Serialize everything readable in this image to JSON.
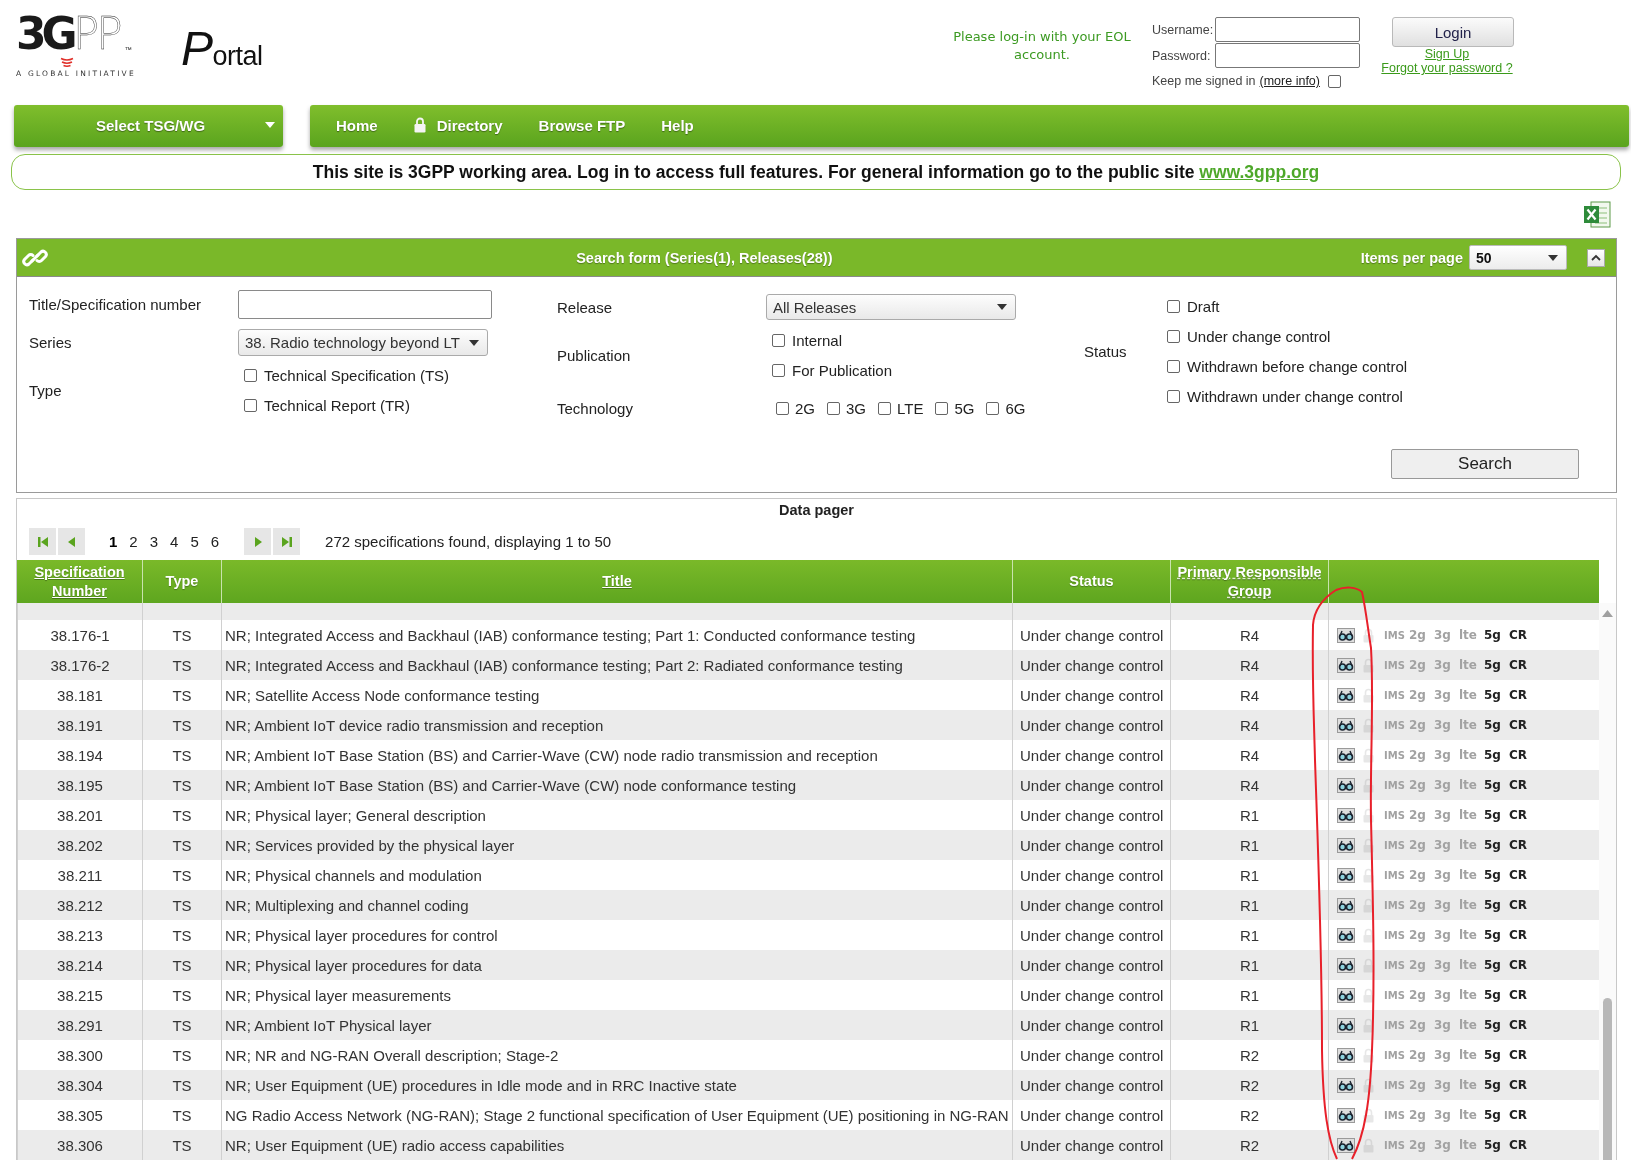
{
  "header": {
    "logo": {
      "wordmark": "3GPP",
      "trademark": "™",
      "tagline": "A GLOBAL INITIATIVE"
    },
    "portal_title": "Portal",
    "login": {
      "prompt": "Please log-in with your EOL account.",
      "username_label": "Username:",
      "password_label": "Password:",
      "keep_signed_in": {
        "label": "Keep me signed in",
        "link": "(more info)",
        "checked": false
      },
      "login_button": "Login",
      "sign_up": "Sign Up",
      "forgot_password": "Forgot your password ?"
    }
  },
  "nav": {
    "tsg_select": "Select TSG/WG",
    "items": [
      {
        "label": "Home",
        "locked": false
      },
      {
        "label": "Directory",
        "locked": true
      },
      {
        "label": "Browse FTP",
        "locked": false
      },
      {
        "label": "Help",
        "locked": false
      }
    ]
  },
  "banner": {
    "text": "This site is 3GPP working area. Log in to access full features. For general information go to the public site",
    "link": "www.3gpp.org"
  },
  "search_form": {
    "title": "Search form (Series(1), Releases(28))",
    "items_per_page_label": "Items per page",
    "items_per_page": "50",
    "expanded": true,
    "title_label": "Title/Specification number",
    "series_label": "Series",
    "series": "38. Radio technology beyond LT",
    "type_label": "Type",
    "types": [
      {
        "label": "Technical Specification (TS)",
        "checked": false
      },
      {
        "label": "Technical Report (TR)",
        "checked": false
      }
    ],
    "release_label": "Release",
    "release": "All Releases",
    "publication_label": "Publication",
    "publications": [
      {
        "label": "Internal",
        "checked": false
      },
      {
        "label": "For Publication",
        "checked": false
      }
    ],
    "technology_label": "Technology",
    "technologies": [
      {
        "label": "2G",
        "checked": false
      },
      {
        "label": "3G",
        "checked": false
      },
      {
        "label": "LTE",
        "checked": false
      },
      {
        "label": "5G",
        "checked": false
      },
      {
        "label": "6G",
        "checked": false
      }
    ],
    "status_label": "Status",
    "statuses": [
      {
        "label": "Draft",
        "checked": false
      },
      {
        "label": "Under change control",
        "checked": false
      },
      {
        "label": "Withdrawn before change control",
        "checked": false
      },
      {
        "label": "Withdrawn under change control",
        "checked": false
      }
    ],
    "search_button": "Search"
  },
  "data_pager": {
    "title": "Data pager",
    "pages": [
      {
        "label": "1",
        "selected": true
      },
      {
        "label": "2",
        "selected": false
      },
      {
        "label": "3",
        "selected": false
      },
      {
        "label": "4",
        "selected": false
      },
      {
        "label": "5",
        "selected": false
      },
      {
        "label": "6",
        "selected": false
      }
    ],
    "summary": "272 specifications found, displaying 1 to 50"
  },
  "table": {
    "columns": [
      {
        "label": "Specification Number",
        "kind": "link"
      },
      {
        "label": "Type",
        "kind": "plain"
      },
      {
        "label": "Title",
        "kind": "link"
      },
      {
        "label": "Status",
        "kind": "plain"
      },
      {
        "label": "Primary Responsible Group",
        "kind": "hint"
      }
    ],
    "rows": [
      {
        "number": "38.176-1",
        "type": "TS",
        "title": "NR; Integrated Access and Backhaul (IAB) conformance testing; Part 1: Conducted conformance testing",
        "status": "Under change control",
        "group": "R4",
        "lock_on": false,
        "tech": [
          {
            "label": "IMS",
            "on": false
          },
          {
            "label": "2g",
            "on": false
          },
          {
            "label": "3g",
            "on": false
          },
          {
            "label": "lte",
            "on": false
          },
          {
            "label": "5g",
            "on": true
          }
        ],
        "cr": "CR"
      },
      {
        "number": "38.176-2",
        "type": "TS",
        "title": "NR; Integrated Access and Backhaul (IAB) conformance testing; Part 2: Radiated conformance testing",
        "status": "Under change control",
        "group": "R4",
        "lock_on": false,
        "tech": [
          {
            "label": "IMS",
            "on": false
          },
          {
            "label": "2g",
            "on": false
          },
          {
            "label": "3g",
            "on": false
          },
          {
            "label": "lte",
            "on": false
          },
          {
            "label": "5g",
            "on": true
          }
        ],
        "cr": "CR"
      },
      {
        "number": "38.181",
        "type": "TS",
        "title": "NR; Satellite Access Node conformance testing",
        "status": "Under change control",
        "group": "R4",
        "lock_on": false,
        "tech": [
          {
            "label": "IMS",
            "on": false
          },
          {
            "label": "2g",
            "on": false
          },
          {
            "label": "3g",
            "on": false
          },
          {
            "label": "lte",
            "on": false
          },
          {
            "label": "5g",
            "on": true
          }
        ],
        "cr": "CR"
      },
      {
        "number": "38.191",
        "type": "TS",
        "title": "NR; Ambient IoT device radio transmission and reception",
        "status": "Under change control",
        "group": "R4",
        "lock_on": false,
        "tech": [
          {
            "label": "IMS",
            "on": false
          },
          {
            "label": "2g",
            "on": false
          },
          {
            "label": "3g",
            "on": false
          },
          {
            "label": "lte",
            "on": false
          },
          {
            "label": "5g",
            "on": true
          }
        ],
        "cr": "CR"
      },
      {
        "number": "38.194",
        "type": "TS",
        "title": "NR; Ambient IoT Base Station (BS) and Carrier-Wave (CW) node radio transmission and reception",
        "status": "Under change control",
        "group": "R4",
        "lock_on": false,
        "tech": [
          {
            "label": "IMS",
            "on": false
          },
          {
            "label": "2g",
            "on": false
          },
          {
            "label": "3g",
            "on": false
          },
          {
            "label": "lte",
            "on": false
          },
          {
            "label": "5g",
            "on": true
          }
        ],
        "cr": "CR"
      },
      {
        "number": "38.195",
        "type": "TS",
        "title": "NR; Ambient IoT Base Station (BS) and Carrier-Wave (CW) node conformance testing",
        "status": "Under change control",
        "group": "R4",
        "lock_on": false,
        "tech": [
          {
            "label": "IMS",
            "on": false
          },
          {
            "label": "2g",
            "on": false
          },
          {
            "label": "3g",
            "on": false
          },
          {
            "label": "lte",
            "on": false
          },
          {
            "label": "5g",
            "on": true
          }
        ],
        "cr": "CR"
      },
      {
        "number": "38.201",
        "type": "TS",
        "title": "NR; Physical layer; General description",
        "status": "Under change control",
        "group": "R1",
        "lock_on": false,
        "tech": [
          {
            "label": "IMS",
            "on": false
          },
          {
            "label": "2g",
            "on": false
          },
          {
            "label": "3g",
            "on": false
          },
          {
            "label": "lte",
            "on": false
          },
          {
            "label": "5g",
            "on": true
          }
        ],
        "cr": "CR"
      },
      {
        "number": "38.202",
        "type": "TS",
        "title": "NR; Services provided by the physical layer",
        "status": "Under change control",
        "group": "R1",
        "lock_on": false,
        "tech": [
          {
            "label": "IMS",
            "on": false
          },
          {
            "label": "2g",
            "on": false
          },
          {
            "label": "3g",
            "on": false
          },
          {
            "label": "lte",
            "on": false
          },
          {
            "label": "5g",
            "on": true
          }
        ],
        "cr": "CR"
      },
      {
        "number": "38.211",
        "type": "TS",
        "title": "NR; Physical channels and modulation",
        "status": "Under change control",
        "group": "R1",
        "lock_on": false,
        "tech": [
          {
            "label": "IMS",
            "on": false
          },
          {
            "label": "2g",
            "on": false
          },
          {
            "label": "3g",
            "on": false
          },
          {
            "label": "lte",
            "on": false
          },
          {
            "label": "5g",
            "on": true
          }
        ],
        "cr": "CR"
      },
      {
        "number": "38.212",
        "type": "TS",
        "title": "NR; Multiplexing and channel coding",
        "status": "Under change control",
        "group": "R1",
        "lock_on": false,
        "tech": [
          {
            "label": "IMS",
            "on": false
          },
          {
            "label": "2g",
            "on": false
          },
          {
            "label": "3g",
            "on": false
          },
          {
            "label": "lte",
            "on": false
          },
          {
            "label": "5g",
            "on": true
          }
        ],
        "cr": "CR"
      },
      {
        "number": "38.213",
        "type": "TS",
        "title": "NR; Physical layer procedures for control",
        "status": "Under change control",
        "group": "R1",
        "lock_on": false,
        "tech": [
          {
            "label": "IMS",
            "on": false
          },
          {
            "label": "2g",
            "on": false
          },
          {
            "label": "3g",
            "on": false
          },
          {
            "label": "lte",
            "on": false
          },
          {
            "label": "5g",
            "on": true
          }
        ],
        "cr": "CR"
      },
      {
        "number": "38.214",
        "type": "TS",
        "title": "NR; Physical layer procedures for data",
        "status": "Under change control",
        "group": "R1",
        "lock_on": false,
        "tech": [
          {
            "label": "IMS",
            "on": false
          },
          {
            "label": "2g",
            "on": false
          },
          {
            "label": "3g",
            "on": false
          },
          {
            "label": "lte",
            "on": false
          },
          {
            "label": "5g",
            "on": true
          }
        ],
        "cr": "CR"
      },
      {
        "number": "38.215",
        "type": "TS",
        "title": "NR; Physical layer measurements",
        "status": "Under change control",
        "group": "R1",
        "lock_on": false,
        "tech": [
          {
            "label": "IMS",
            "on": false
          },
          {
            "label": "2g",
            "on": false
          },
          {
            "label": "3g",
            "on": false
          },
          {
            "label": "lte",
            "on": false
          },
          {
            "label": "5g",
            "on": true
          }
        ],
        "cr": "CR"
      },
      {
        "number": "38.291",
        "type": "TS",
        "title": "NR; Ambient IoT Physical layer",
        "status": "Under change control",
        "group": "R1",
        "lock_on": false,
        "tech": [
          {
            "label": "IMS",
            "on": false
          },
          {
            "label": "2g",
            "on": false
          },
          {
            "label": "3g",
            "on": false
          },
          {
            "label": "lte",
            "on": false
          },
          {
            "label": "5g",
            "on": true
          }
        ],
        "cr": "CR"
      },
      {
        "number": "38.300",
        "type": "TS",
        "title": "NR; NR and NG-RAN Overall description; Stage-2",
        "status": "Under change control",
        "group": "R2",
        "lock_on": false,
        "tech": [
          {
            "label": "IMS",
            "on": false
          },
          {
            "label": "2g",
            "on": false
          },
          {
            "label": "3g",
            "on": false
          },
          {
            "label": "lte",
            "on": false
          },
          {
            "label": "5g",
            "on": true
          }
        ],
        "cr": "CR"
      },
      {
        "number": "38.304",
        "type": "TS",
        "title": "NR; User Equipment (UE) procedures in Idle mode and in RRC Inactive state",
        "status": "Under change control",
        "group": "R2",
        "lock_on": false,
        "tech": [
          {
            "label": "IMS",
            "on": false
          },
          {
            "label": "2g",
            "on": false
          },
          {
            "label": "3g",
            "on": false
          },
          {
            "label": "lte",
            "on": false
          },
          {
            "label": "5g",
            "on": true
          }
        ],
        "cr": "CR"
      },
      {
        "number": "38.305",
        "type": "TS",
        "title": "NG Radio Access Network (NG-RAN); Stage 2 functional specification of User Equipment (UE) positioning in NG-RAN",
        "status": "Under change control",
        "group": "R2",
        "lock_on": false,
        "tech": [
          {
            "label": "IMS",
            "on": false
          },
          {
            "label": "2g",
            "on": false
          },
          {
            "label": "3g",
            "on": false
          },
          {
            "label": "lte",
            "on": false
          },
          {
            "label": "5g",
            "on": true
          }
        ],
        "cr": "CR"
      },
      {
        "number": "38.306",
        "type": "TS",
        "title": "NR; User Equipment (UE) radio access capabilities",
        "status": "Under change control",
        "group": "R2",
        "lock_on": false,
        "tech": [
          {
            "label": "IMS",
            "on": false
          },
          {
            "label": "2g",
            "on": false
          },
          {
            "label": "3g",
            "on": false
          },
          {
            "label": "lte",
            "on": false
          },
          {
            "label": "5g",
            "on": true
          }
        ],
        "cr": "CR"
      }
    ]
  },
  "annotations": [
    {
      "kind": "loop"
    }
  ]
}
